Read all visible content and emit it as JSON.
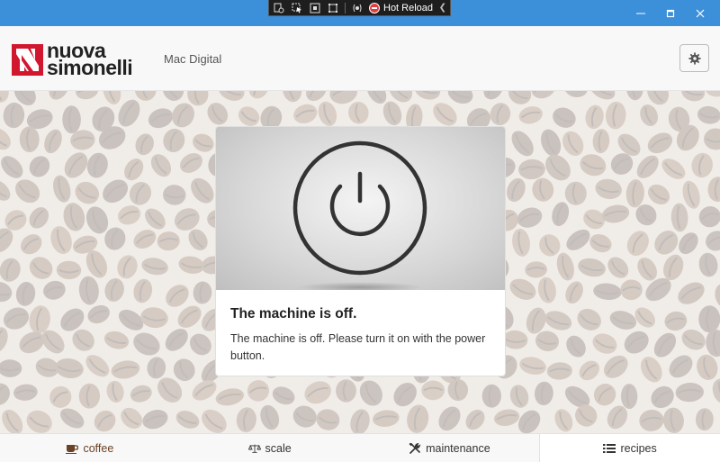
{
  "debug_toolbar": {
    "hot_reload_label": "Hot Reload"
  },
  "header": {
    "brand_line1": "nuova",
    "brand_line2": "simonelli",
    "app_title": "Mac Digital"
  },
  "card": {
    "title": "The machine is off.",
    "text": "The machine is off. Please turn it on with the power button."
  },
  "nav": {
    "items": [
      {
        "label": "coffee",
        "icon": "coffee-cup-icon"
      },
      {
        "label": "scale",
        "icon": "balance-scale-icon"
      },
      {
        "label": "maintenance",
        "icon": "tools-icon"
      },
      {
        "label": "recipes",
        "icon": "list-icon"
      }
    ],
    "active": "recipes"
  },
  "colors": {
    "titlebar": "#3c8fd9",
    "brand_red": "#d1172e",
    "coffee_brown": "#6b4226"
  }
}
